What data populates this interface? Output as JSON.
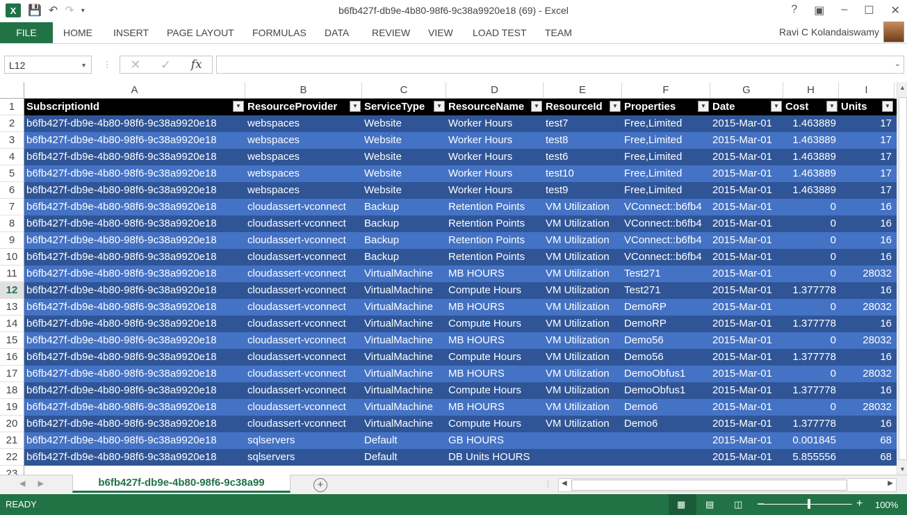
{
  "window": {
    "title": "b6fb427f-db9e-4b80-98f6-9c38a9920e18 (69) - Excel",
    "help": "?",
    "controls": [
      "–",
      "☐",
      "✕"
    ]
  },
  "qat": {
    "logo": "X",
    "save_icon": "save-icon",
    "undo_icon": "undo-icon",
    "redo_icon": "redo-icon"
  },
  "ribbon": {
    "tabs": [
      "FILE",
      "HOME",
      "INSERT",
      "PAGE LAYOUT",
      "FORMULAS",
      "DATA",
      "REVIEW",
      "VIEW",
      "LOAD TEST",
      "TEAM"
    ],
    "user": "Ravi C Kolandaiswamy"
  },
  "formula_bar": {
    "name_box": "L12",
    "fx": "fx",
    "value": ""
  },
  "columns": [
    "A",
    "B",
    "C",
    "D",
    "E",
    "F",
    "G",
    "H",
    "I"
  ],
  "headers": [
    "SubscriptionId",
    "ResourceProvider",
    "ServiceType",
    "ResourceName",
    "ResourceId",
    "Properties",
    "Date",
    "Cost",
    "Units"
  ],
  "selected_row": 12,
  "rows": [
    [
      "b6fb427f-db9e-4b80-98f6-9c38a9920e18",
      "webspaces",
      "Website",
      "Worker Hours",
      "test7",
      "Free,Limited",
      "2015-Mar-01",
      "1.463889",
      "17"
    ],
    [
      "b6fb427f-db9e-4b80-98f6-9c38a9920e18",
      "webspaces",
      "Website",
      "Worker Hours",
      "test8",
      "Free,Limited",
      "2015-Mar-01",
      "1.463889",
      "17"
    ],
    [
      "b6fb427f-db9e-4b80-98f6-9c38a9920e18",
      "webspaces",
      "Website",
      "Worker Hours",
      "test6",
      "Free,Limited",
      "2015-Mar-01",
      "1.463889",
      "17"
    ],
    [
      "b6fb427f-db9e-4b80-98f6-9c38a9920e18",
      "webspaces",
      "Website",
      "Worker Hours",
      "test10",
      "Free,Limited",
      "2015-Mar-01",
      "1.463889",
      "17"
    ],
    [
      "b6fb427f-db9e-4b80-98f6-9c38a9920e18",
      "webspaces",
      "Website",
      "Worker Hours",
      "test9",
      "Free,Limited",
      "2015-Mar-01",
      "1.463889",
      "17"
    ],
    [
      "b6fb427f-db9e-4b80-98f6-9c38a9920e18",
      "cloudassert-vconnect",
      "Backup",
      "Retention Points",
      "VM Utilization",
      "VConnect::b6fb4",
      "2015-Mar-01",
      "0",
      "16"
    ],
    [
      "b6fb427f-db9e-4b80-98f6-9c38a9920e18",
      "cloudassert-vconnect",
      "Backup",
      "Retention Points",
      "VM Utilization",
      "VConnect::b6fb4",
      "2015-Mar-01",
      "0",
      "16"
    ],
    [
      "b6fb427f-db9e-4b80-98f6-9c38a9920e18",
      "cloudassert-vconnect",
      "Backup",
      "Retention Points",
      "VM Utilization",
      "VConnect::b6fb4",
      "2015-Mar-01",
      "0",
      "16"
    ],
    [
      "b6fb427f-db9e-4b80-98f6-9c38a9920e18",
      "cloudassert-vconnect",
      "Backup",
      "Retention Points",
      "VM Utilization",
      "VConnect::b6fb4",
      "2015-Mar-01",
      "0",
      "16"
    ],
    [
      "b6fb427f-db9e-4b80-98f6-9c38a9920e18",
      "cloudassert-vconnect",
      "VirtualMachine",
      "MB HOURS",
      "VM Utilization",
      "Test271",
      "2015-Mar-01",
      "0",
      "28032"
    ],
    [
      "b6fb427f-db9e-4b80-98f6-9c38a9920e18",
      "cloudassert-vconnect",
      "VirtualMachine",
      "Compute Hours",
      "VM Utilization",
      "Test271",
      "2015-Mar-01",
      "1.377778",
      "16"
    ],
    [
      "b6fb427f-db9e-4b80-98f6-9c38a9920e18",
      "cloudassert-vconnect",
      "VirtualMachine",
      "MB HOURS",
      "VM Utilization",
      "DemoRP",
      "2015-Mar-01",
      "0",
      "28032"
    ],
    [
      "b6fb427f-db9e-4b80-98f6-9c38a9920e18",
      "cloudassert-vconnect",
      "VirtualMachine",
      "Compute Hours",
      "VM Utilization",
      "DemoRP",
      "2015-Mar-01",
      "1.377778",
      "16"
    ],
    [
      "b6fb427f-db9e-4b80-98f6-9c38a9920e18",
      "cloudassert-vconnect",
      "VirtualMachine",
      "MB HOURS",
      "VM Utilization",
      "Demo56",
      "2015-Mar-01",
      "0",
      "28032"
    ],
    [
      "b6fb427f-db9e-4b80-98f6-9c38a9920e18",
      "cloudassert-vconnect",
      "VirtualMachine",
      "Compute Hours",
      "VM Utilization",
      "Demo56",
      "2015-Mar-01",
      "1.377778",
      "16"
    ],
    [
      "b6fb427f-db9e-4b80-98f6-9c38a9920e18",
      "cloudassert-vconnect",
      "VirtualMachine",
      "MB HOURS",
      "VM Utilization",
      "DemoObfus1",
      "2015-Mar-01",
      "0",
      "28032"
    ],
    [
      "b6fb427f-db9e-4b80-98f6-9c38a9920e18",
      "cloudassert-vconnect",
      "VirtualMachine",
      "Compute Hours",
      "VM Utilization",
      "DemoObfus1",
      "2015-Mar-01",
      "1.377778",
      "16"
    ],
    [
      "b6fb427f-db9e-4b80-98f6-9c38a9920e18",
      "cloudassert-vconnect",
      "VirtualMachine",
      "MB HOURS",
      "VM Utilization",
      "Demo6",
      "2015-Mar-01",
      "0",
      "28032"
    ],
    [
      "b6fb427f-db9e-4b80-98f6-9c38a9920e18",
      "cloudassert-vconnect",
      "VirtualMachine",
      "Compute Hours",
      "VM Utilization",
      "Demo6",
      "2015-Mar-01",
      "1.377778",
      "16"
    ],
    [
      "b6fb427f-db9e-4b80-98f6-9c38a9920e18",
      "sqlservers",
      "Default",
      "GB HOURS",
      "",
      "",
      "2015-Mar-01",
      "0.001845",
      "68"
    ],
    [
      "b6fb427f-db9e-4b80-98f6-9c38a9920e18",
      "sqlservers",
      "Default",
      "DB Units HOURS",
      "",
      "",
      "2015-Mar-01",
      "5.855556",
      "68"
    ]
  ],
  "trailing_row_number": "23",
  "sheet_tab": "b6fb427f-db9e-4b80-98f6-9c38a99",
  "status": {
    "text": "READY",
    "zoom": "100%",
    "zoom_level": 1.0
  },
  "colors": {
    "accent": "#217346",
    "row_dark": "#2f5597",
    "row_light": "#4472c4",
    "header_bg": "#000000"
  }
}
